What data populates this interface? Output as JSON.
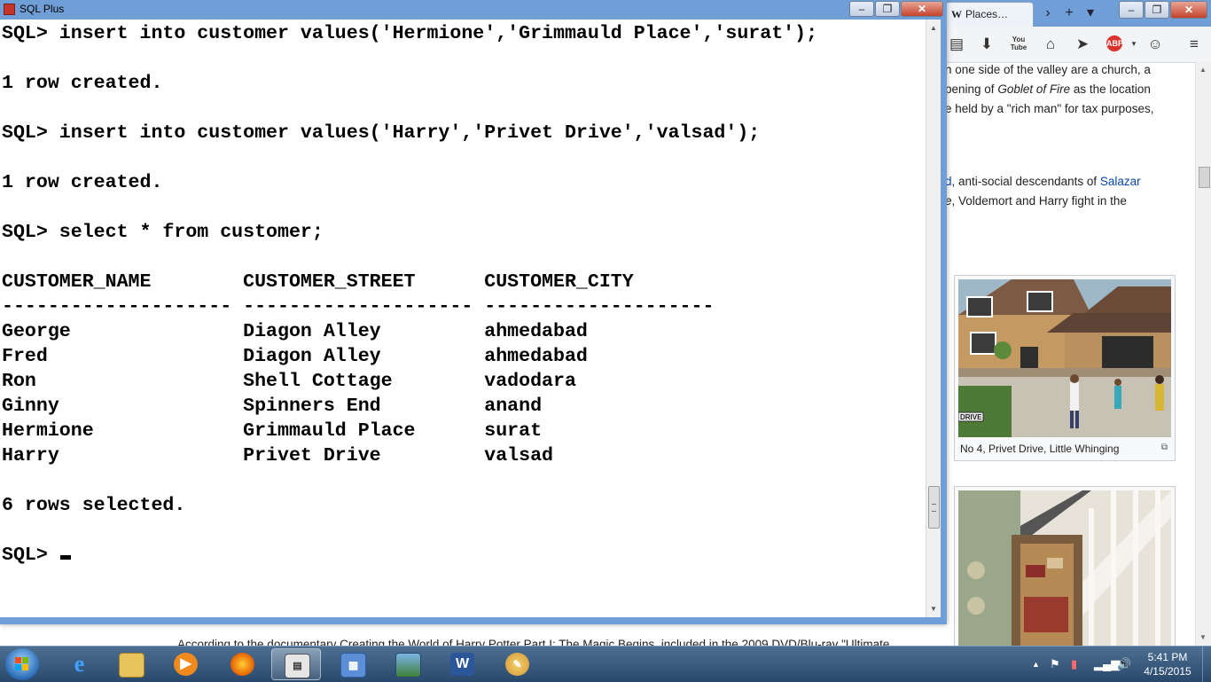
{
  "browser": {
    "tab_title": "Places…",
    "tab_logo": "W",
    "wiki_lines": [
      {
        "parts": [
          {
            "t": "n one side of the valley are a church, a",
            "k": "text"
          }
        ]
      },
      {
        "parts": [
          {
            "t": "pening of ",
            "k": "text"
          },
          {
            "t": "Goblet of Fire",
            "k": "em"
          },
          {
            "t": " as the location",
            "k": "text"
          }
        ]
      },
      {
        "parts": [
          {
            "t": "e held by a \"rich man\" for tax purposes,",
            "k": "text"
          }
        ]
      },
      {
        "parts": [
          {
            "t": "d",
            "k": "link"
          },
          {
            "t": ", anti-social descendants of ",
            "k": "text"
          },
          {
            "t": "Salazar",
            "k": "link"
          }
        ]
      },
      {
        "parts": [
          {
            "t": "e",
            "k": "em"
          },
          {
            "t": ", Voldemort and Harry fight in the",
            "k": "text"
          }
        ]
      }
    ],
    "thumb1_caption": "No 4, Privet Drive, Little Whinging",
    "thumb1_sign": "DRIVE",
    "bottom_text": "According to the documentary Creating the World of Harry Potter Part I: The Magic Begins, included in the 2009 DVD/Blu-ray \"Ultimate"
  },
  "sqlplus": {
    "title": "SQL Plus",
    "lines": [
      "SQL> insert into customer values('Hermione','Grimmauld Place','surat');",
      "",
      "1 row created.",
      "",
      "SQL> insert into customer values('Harry','Privet Drive','valsad');",
      "",
      "1 row created.",
      "",
      "SQL> select * from customer;",
      "",
      "CUSTOMER_NAME        CUSTOMER_STREET      CUSTOMER_CITY",
      "-------------------- -------------------- --------------------",
      "George               Diagon Alley         ahmedabad",
      "Fred                 Diagon Alley         ahmedabad",
      "Ron                  Shell Cottage        vadodara",
      "Ginny                Spinners End         anand",
      "Hermione             Grimmauld Place      surat",
      "Harry                Privet Drive         valsad",
      "",
      "6 rows selected.",
      ""
    ],
    "prompt": "SQL> "
  },
  "taskbar": {
    "clock_time": "5:41 PM",
    "clock_date": "4/15/2015"
  },
  "icons": [
    "windows-start-icon",
    "internet-explorer-icon",
    "file-explorer-icon",
    "media-player-icon",
    "firefox-icon",
    "sqlplus-taskbar-icon",
    "control-panel-icon",
    "photo-viewer-icon",
    "word-icon",
    "paint-icon"
  ]
}
